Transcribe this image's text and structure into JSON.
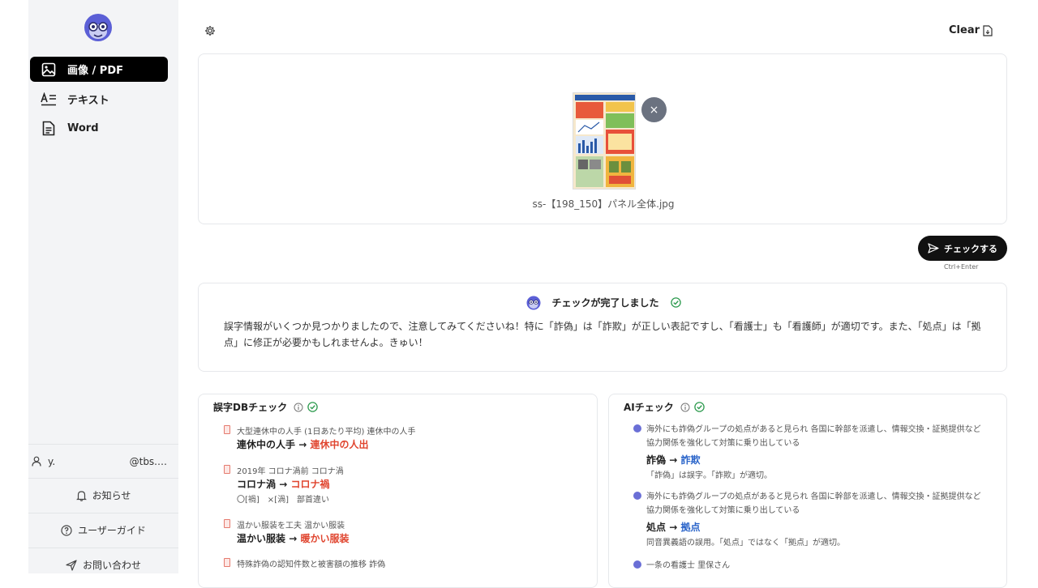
{
  "sidebar": {
    "logo_name": "mascot-logo",
    "items": [
      {
        "label": "画像 / PDF",
        "icon": "image-icon",
        "active": true
      },
      {
        "label": "テキスト",
        "icon": "text-icon",
        "active": false
      },
      {
        "label": "Word",
        "icon": "document-icon",
        "active": false
      }
    ],
    "user": {
      "name": "y.",
      "email": "@tbs.…"
    },
    "links": [
      {
        "label": "お知らせ",
        "icon": "bell-icon"
      },
      {
        "label": "ユーザーガイド",
        "icon": "help-circle-icon"
      },
      {
        "label": "お問い合わせ",
        "icon": "send-icon"
      }
    ]
  },
  "toolbar": {
    "clear_label": "Clear",
    "settings_icon": "gear-icon",
    "export_icon": "file-export-icon"
  },
  "upload": {
    "file_name": "ss-【198_150】パネル全体.jpg",
    "remove_label": "×"
  },
  "action": {
    "check_label": "チェックする",
    "shortcut": "Ctrl+Enter"
  },
  "result": {
    "title": "チェックが完了しました",
    "message": "誤字情報がいくつか見つかりましたので、注意してみてくださいね！特に「詐偽」は「詐欺」が正しい表記ですし、「看護士」も「看護師」が適切です。また、「処点」は「拠点」に修正が必要かもしれませんよ。きゅい！"
  },
  "db_check": {
    "title": "誤字DBチェック",
    "items": [
      {
        "source": "大型連休中の人手 (1日あたり平均) 連休中の人手",
        "from": "連休中の人手",
        "arrow": "→",
        "to": "連休中の人出",
        "note": ""
      },
      {
        "source": "2019年 コロナ渦前 コロナ渦",
        "from": "コロナ渦",
        "arrow": "→",
        "to": "コロナ禍",
        "note": "〇[禍]　×[渦]　部首違い"
      },
      {
        "source": "温かい服装を工夫 温かい服装",
        "from": "温かい服装",
        "arrow": "→",
        "to": "暖かい服装",
        "note": ""
      },
      {
        "source": "特殊詐偽の認知件数と被害額の推移 詐偽",
        "from": "",
        "arrow": "",
        "to": "",
        "note": ""
      }
    ]
  },
  "ai_check": {
    "title": "AIチェック",
    "items": [
      {
        "source": "海外にも詐偽グループの処点があると見られ 各国に幹部を派遣し、情報交換・証拠提供など 協力関係を強化して対策に乗り出している",
        "from": "詐偽",
        "arrow": "→",
        "to": "詐欺",
        "note": "「詐偽」は誤字。「詐欺」が適切。"
      },
      {
        "source": "海外にも詐偽グループの処点があると見られ 各国に幹部を派遣し、情報交換・証拠提供など 協力関係を強化して対策に乗り出している",
        "from": "処点",
        "arrow": "→",
        "to": "拠点",
        "note": "同音異義語の誤用。「処点」ではなく「拠点」が適切。"
      },
      {
        "source": "一条の看護士 里保さん",
        "from": "",
        "arrow": "",
        "to": "",
        "note": ""
      }
    ]
  },
  "colors": {
    "accent_red": "#e0452f",
    "accent_blue": "#2a64c9",
    "ok_green": "#2e9b4f",
    "mascot": "#5b5fd6"
  }
}
